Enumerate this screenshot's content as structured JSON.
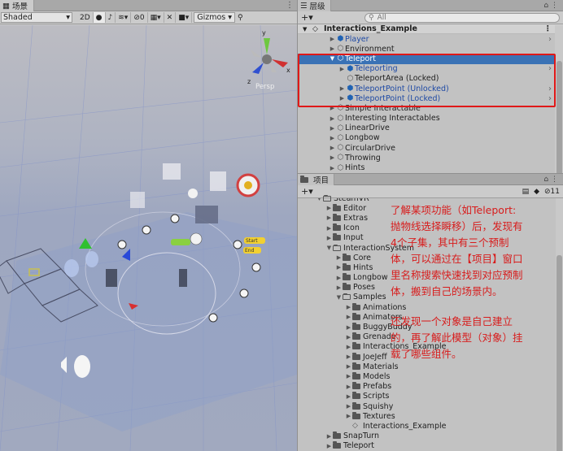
{
  "scene": {
    "tab_label": "场景",
    "shading": "Shaded",
    "mode_2d": "2D",
    "hidden_count": "0",
    "gizmos": "Gizmos",
    "persp": "Persp",
    "labels": {
      "start": "Start",
      "end": "End"
    }
  },
  "hierarchy": {
    "tab_label": "层级",
    "search_placeholder": "All",
    "scene_name": "Interactions_Example",
    "items": [
      {
        "label": "Player"
      },
      {
        "label": "Environment"
      },
      {
        "label": "Teleport"
      },
      {
        "label": "Teleporting"
      },
      {
        "label": "TeleportArea (Locked)"
      },
      {
        "label": "TeleportPoint (Unlocked)"
      },
      {
        "label": "TeleportPoint (Locked)"
      },
      {
        "label": "Simple Interactable"
      },
      {
        "label": "Interesting Interactables"
      },
      {
        "label": "LinearDrive"
      },
      {
        "label": "Longbow"
      },
      {
        "label": "CircularDrive"
      },
      {
        "label": "Throwing"
      },
      {
        "label": "Hints"
      }
    ]
  },
  "project": {
    "tab_label": "项目",
    "hidden_count": "11",
    "items": [
      {
        "label": "SteamVR"
      },
      {
        "label": "Editor"
      },
      {
        "label": "Extras"
      },
      {
        "label": "Icon"
      },
      {
        "label": "Input"
      },
      {
        "label": "InteractionSystem"
      },
      {
        "label": "Core"
      },
      {
        "label": "Hints"
      },
      {
        "label": "Longbow"
      },
      {
        "label": "Poses"
      },
      {
        "label": "Samples"
      },
      {
        "label": "Animations"
      },
      {
        "label": "Animators"
      },
      {
        "label": "BuggyBuddy"
      },
      {
        "label": "Grenade"
      },
      {
        "label": "Interactions_Example"
      },
      {
        "label": "JoeJeff"
      },
      {
        "label": "Materials"
      },
      {
        "label": "Models"
      },
      {
        "label": "Prefabs"
      },
      {
        "label": "Scripts"
      },
      {
        "label": "Squishy"
      },
      {
        "label": "Textures"
      },
      {
        "label": "Interactions_Example"
      },
      {
        "label": "SnapTurn"
      },
      {
        "label": "Teleport"
      }
    ]
  },
  "annotations": {
    "note1": [
      "了解某项功能（如Teleport:",
      "抛物线选择瞬移）后，发现有",
      "4个子集，其中有三个预制",
      "体，可以通过在【项目】窗口",
      "里名称搜索快速找到对应预制",
      "体，搬到自己的场景内。"
    ],
    "note2": [
      "还发现一个对象是自己建立",
      "的，再了解此模型（对象）挂",
      "载了哪些组件。"
    ]
  },
  "colors": {
    "selection": "#3a72b5",
    "prefab_blue": "#1f4aa5",
    "annotation_red": "#d81c1c"
  }
}
